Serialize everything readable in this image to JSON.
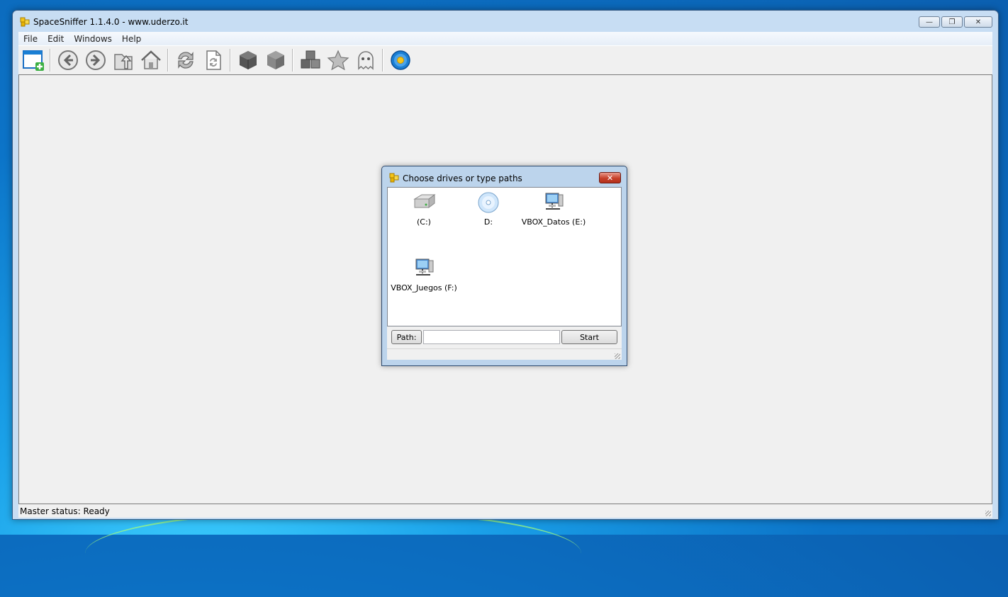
{
  "window": {
    "title": "SpaceSniffer 1.1.4.0 - www.uderzo.it",
    "controls": {
      "minimize": "—",
      "restore": "❐",
      "close": "✕"
    }
  },
  "menu": [
    "File",
    "Edit",
    "Windows",
    "Help"
  ],
  "toolbar": [
    {
      "name": "new-window-icon"
    },
    {
      "name": "back-icon"
    },
    {
      "name": "forward-icon"
    },
    {
      "name": "up-icon"
    },
    {
      "name": "home-icon"
    },
    {
      "name": "refresh-icon"
    },
    {
      "name": "refresh-document-icon"
    },
    {
      "name": "cube-dark-icon"
    },
    {
      "name": "cube-grey-icon"
    },
    {
      "name": "cubes-icon"
    },
    {
      "name": "star-icon"
    },
    {
      "name": "ghost-icon"
    },
    {
      "name": "flower-icon"
    }
  ],
  "status": "Master status: Ready",
  "dialog": {
    "title": "Choose drives or type paths",
    "close": "✕",
    "drives": [
      {
        "label": "(C:)",
        "icon": "hard-drive-icon"
      },
      {
        "label": "D:",
        "icon": "optical-drive-icon"
      },
      {
        "label": "VBOX_Datos (E:)",
        "icon": "network-drive-icon"
      },
      {
        "label": "VBOX_Juegos (F:)",
        "icon": "network-drive-icon"
      }
    ],
    "path_button": "Path:",
    "path_value": "",
    "start_button": "Start"
  },
  "colors": {
    "accent": "#1a7fd4",
    "close_red": "#c7402a"
  }
}
